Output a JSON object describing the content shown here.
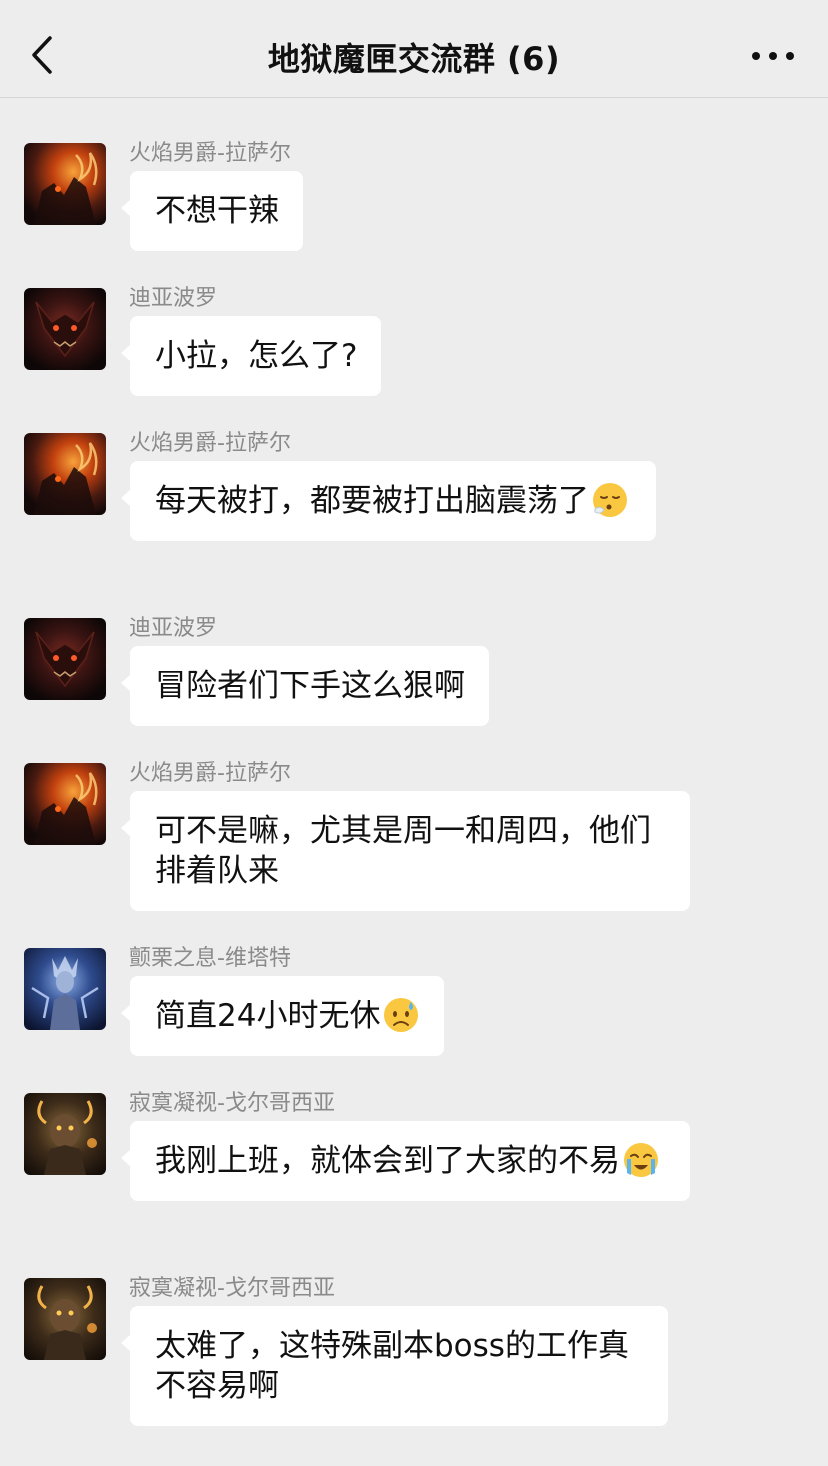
{
  "header": {
    "title": "地狱魔匣交流群 (6)",
    "back_icon": "chevron-left-icon",
    "more_icon": "ellipsis-icon"
  },
  "messages": [
    {
      "sender": "火焰男爵-拉萨尔",
      "avatar": "lazarus-avatar",
      "text": "不想干辣",
      "emoji": ""
    },
    {
      "sender": "迪亚波罗",
      "avatar": "diablo-avatar",
      "text": "小拉，怎么了?",
      "emoji": ""
    },
    {
      "sender": "火焰男爵-拉萨尔",
      "avatar": "lazarus-avatar",
      "text": "每天被打，都要被打出脑震荡了",
      "emoji": "exhaling-face-icon"
    },
    {
      "sender": "迪亚波罗",
      "avatar": "diablo-avatar",
      "text": "冒险者们下手这么狠啊",
      "emoji": ""
    },
    {
      "sender": "火焰男爵-拉萨尔",
      "avatar": "lazarus-avatar",
      "text": "可不是嘛，尤其是周一和周四，他们排着队来",
      "emoji": ""
    },
    {
      "sender": "颤栗之息-维塔特",
      "avatar": "vitat-avatar",
      "text": "简直24小时无休",
      "emoji": "sad-sweat-face-icon"
    },
    {
      "sender": "寂寞凝视-戈尔哥西亚",
      "avatar": "gorgothia-avatar",
      "text": "我刚上班，就体会到了大家的不易",
      "emoji": "loudly-crying-face-icon"
    },
    {
      "sender": "寂寞凝视-戈尔哥西亚",
      "avatar": "gorgothia-avatar",
      "text": "太难了，这特殊副本boss的工作真不容易啊",
      "emoji": ""
    }
  ],
  "colors": {
    "background": "#EDEDED",
    "bubble": "#FFFFFF",
    "sender_name": "#8A8A8A",
    "text": "#111111"
  }
}
